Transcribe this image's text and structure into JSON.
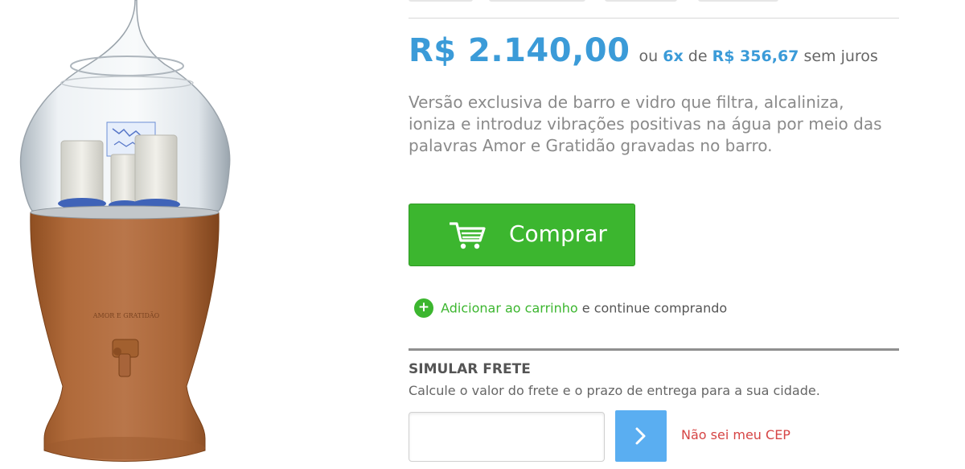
{
  "product": {
    "image_icon": "water-filter-product-photo",
    "image_engraving": "AMOR E GRATIDÃO"
  },
  "price": {
    "main": "R$ 2.140,00",
    "or_label": "ou",
    "installments": "6x",
    "of_label": "de",
    "installment_value": "R$ 356,67",
    "interest_label": "sem juros"
  },
  "description": "Versão exclusiva de barro e vidro que filtra, alcaliniza, ioniza e introduz vibrações positivas na água por meio das palavras Amor e Gratidão gravadas no barro.",
  "buy": {
    "label": "Comprar",
    "icon": "shopping-cart-icon"
  },
  "add_to_cart": {
    "link_label": "Adicionar ao carrinho",
    "rest_label": "e continue comprando"
  },
  "shipping": {
    "title": "SIMULAR FRETE",
    "description": "Calcule o valor do frete e o prazo de entrega para a sua cidade.",
    "cep_value": "",
    "help_link": "Não sei meu CEP"
  },
  "colors": {
    "price_blue": "#3b9bd8",
    "buy_green": "#3cb62f",
    "submit_blue": "#5aaef1",
    "help_red": "#d64545"
  }
}
